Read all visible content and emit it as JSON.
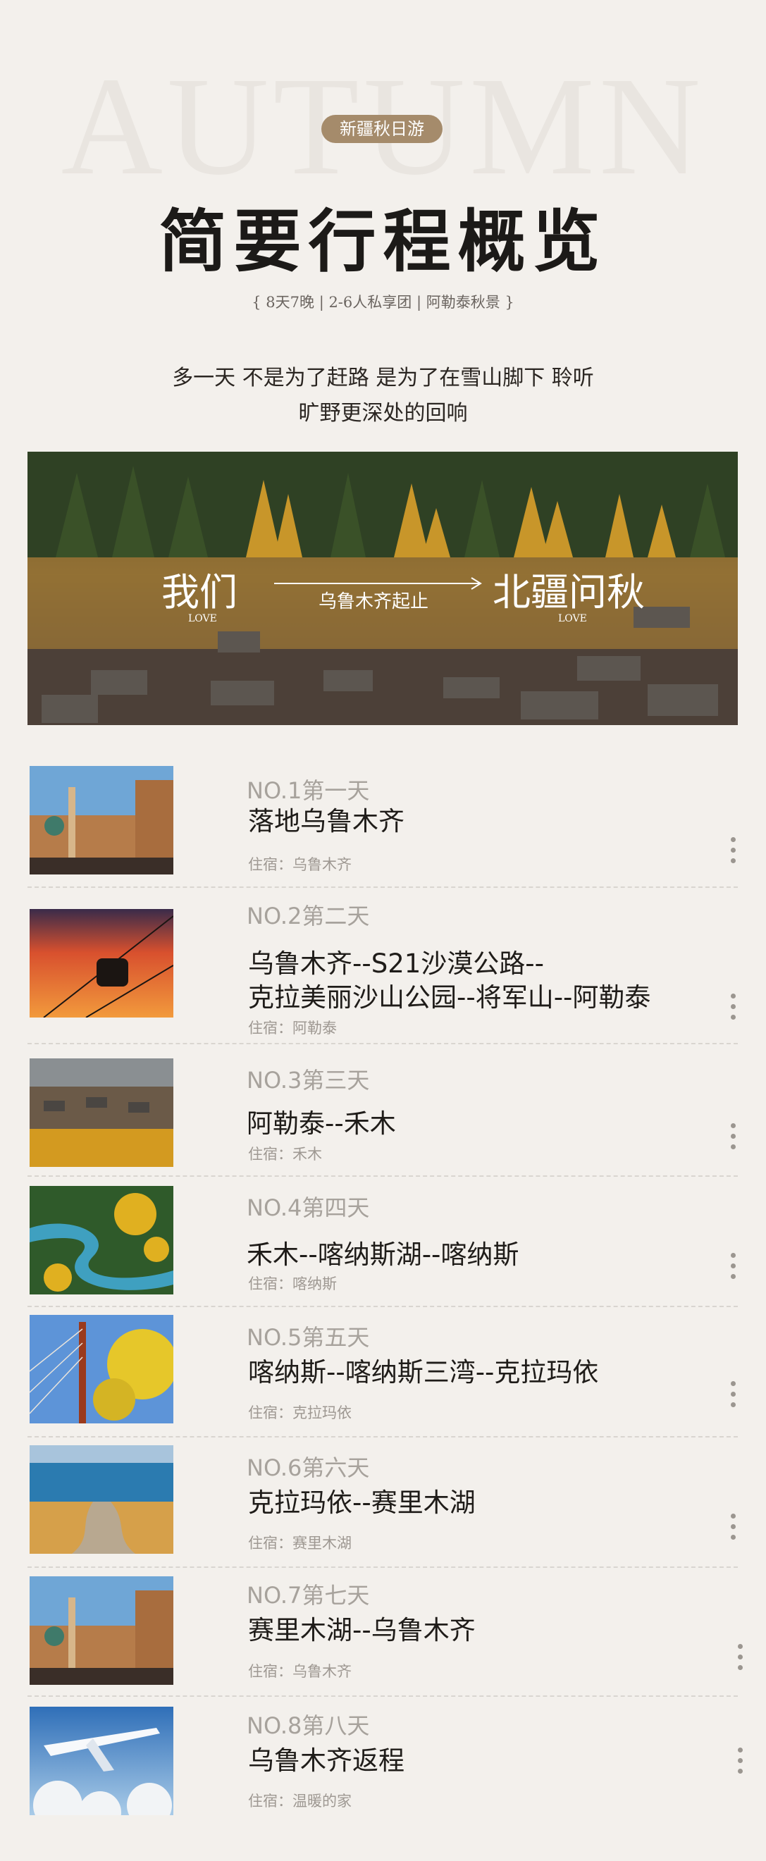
{
  "header": {
    "bg_word": "AUTUMN",
    "tag": "新疆秋日游",
    "title": "简要行程概览",
    "subtitle": "{  8天7晚 | 2-6人私享团 | 阿勒泰秋景  }",
    "slogan_line1": "多一天  不是为了赶路  是为了在雪山脚下  聆听",
    "slogan_line2": "旷野更深处的回响"
  },
  "banner": {
    "left_text": "我们",
    "left_love": "LOVE",
    "route_text": "乌鲁木齐起止",
    "right_text": "北疆问秋",
    "right_love": "LOVE"
  },
  "days": [
    {
      "no": "NO.1第一天",
      "route": "落地乌鲁木齐",
      "route2": "",
      "stay": "住宿：乌鲁木齐",
      "thumb": "bazaar-photo"
    },
    {
      "no": "NO.2第二天",
      "route": "乌鲁木齐--S21沙漠公路--",
      "route2": "克拉美丽沙山公园--将军山--阿勒泰",
      "stay": "住宿：阿勒泰",
      "thumb": "cable-car-sunset-photo"
    },
    {
      "no": "NO.3第三天",
      "route": "阿勒泰--禾木",
      "route2": "",
      "stay": "住宿：禾木",
      "thumb": "village-autumn-photo"
    },
    {
      "no": "NO.4第四天",
      "route": "禾木--喀纳斯湖--喀纳斯",
      "route2": "",
      "stay": "住宿：喀纳斯",
      "thumb": "river-bend-photo"
    },
    {
      "no": "NO.5第五天",
      "route": "喀纳斯--喀纳斯三湾--克拉玛依",
      "route2": "",
      "stay": "住宿：克拉玛依",
      "thumb": "bridge-tower-photo"
    },
    {
      "no": "NO.6第六天",
      "route": "克拉玛依--赛里木湖",
      "route2": "",
      "stay": "住宿：赛里木湖",
      "thumb": "lake-path-photo"
    },
    {
      "no": "NO.7第七天",
      "route": "赛里木湖--乌鲁木齐",
      "route2": "",
      "stay": "住宿：乌鲁木齐",
      "thumb": "bazaar-photo"
    },
    {
      "no": "NO.8第八天",
      "route": "乌鲁木齐返程",
      "route2": "",
      "stay": "住宿：温暖的家",
      "thumb": "airplane-photo"
    }
  ],
  "colors": {
    "tag_bg": "#a58b6b",
    "page_bg": "#f3f0ec"
  }
}
